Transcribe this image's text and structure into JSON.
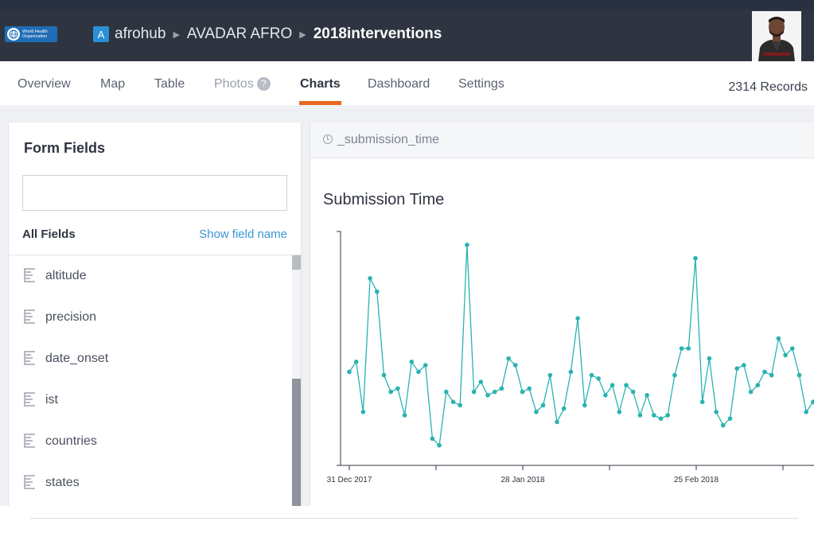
{
  "header": {
    "org_logo_line1": "World Health",
    "org_logo_line2": "Organization",
    "account_initial": "A",
    "breadcrumb": [
      "afrohub",
      "AVADAR AFRO",
      "2018interventions"
    ]
  },
  "tabs": [
    {
      "label": "Overview"
    },
    {
      "label": "Map"
    },
    {
      "label": "Table"
    },
    {
      "label": "Photos",
      "help": "?"
    },
    {
      "label": "Charts"
    },
    {
      "label": "Dashboard"
    },
    {
      "label": "Settings"
    }
  ],
  "active_tab": "Charts",
  "records_label": "2314 Records",
  "form_fields": {
    "title": "Form Fields",
    "search_value": "",
    "all_fields_label": "All Fields",
    "show_field_name_label": "Show field name",
    "items": [
      "altitude",
      "precision",
      "date_onset",
      "ist",
      "countries",
      "states"
    ]
  },
  "chart_panel": {
    "field_tag": "_submission_time",
    "title": "Submission Time"
  },
  "colors": {
    "topbar": "#2f3441",
    "accent": "#e8671f",
    "link": "#3a96d4",
    "series": "#29b3b1"
  },
  "chart_data": {
    "type": "line",
    "title": "Submission Time",
    "xlabel": "",
    "ylabel": "",
    "x_tick_labels": [
      "31 Dec 2017",
      "28 Jan 2018",
      "25 Feb 2018"
    ],
    "x_start": "2017-12-31",
    "grid": false,
    "legend": "none",
    "series": [
      {
        "values": [
          28,
          31,
          16,
          56,
          52,
          27,
          22,
          23,
          15,
          31,
          28,
          30,
          8,
          6,
          22,
          19,
          18,
          66,
          22,
          25,
          21,
          22,
          23,
          32,
          30,
          22,
          23,
          16,
          18,
          27,
          13,
          17,
          28,
          44,
          18,
          27,
          26,
          21,
          24,
          16,
          24,
          22,
          15,
          21,
          15,
          14,
          15,
          27,
          35,
          35,
          62,
          19,
          32,
          16,
          12,
          14,
          29,
          30,
          22,
          24,
          28,
          27,
          38,
          33,
          35,
          27,
          16,
          19,
          14,
          24,
          22,
          25,
          20,
          11,
          13,
          14,
          13
        ]
      }
    ]
  }
}
